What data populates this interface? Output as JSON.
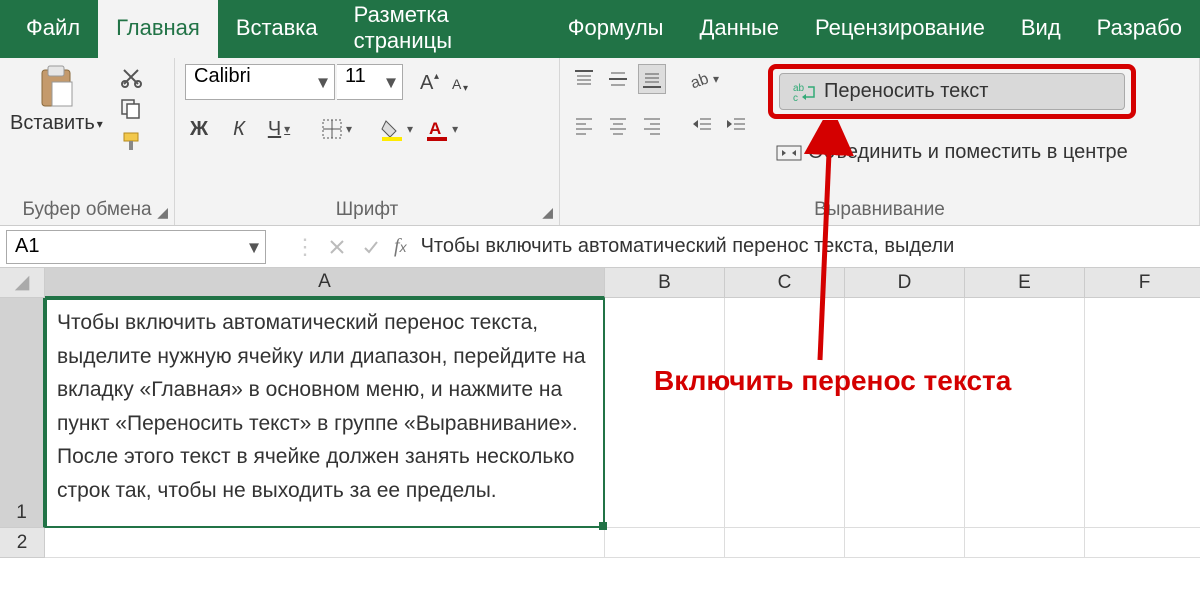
{
  "tabs": {
    "file": "Файл",
    "home": "Главная",
    "insert": "Вставка",
    "page_layout": "Разметка страницы",
    "formulas": "Формулы",
    "data": "Данные",
    "review": "Рецензирование",
    "view": "Вид",
    "developer": "Разрабо"
  },
  "ribbon": {
    "clipboard": {
      "paste": "Вставить",
      "label": "Буфер обмена"
    },
    "font": {
      "name": "Calibri",
      "size": "11",
      "bold": "Ж",
      "italic": "К",
      "underline": "Ч",
      "label": "Шрифт"
    },
    "alignment": {
      "wrap": "Переносить текст",
      "merge": "Объединить и поместить в центре",
      "label": "Выравнивание"
    }
  },
  "formula_bar": {
    "name_box": "A1",
    "content": "Чтобы включить автоматический перенос текста, выдели"
  },
  "grid": {
    "cols": [
      "A",
      "B",
      "C",
      "D",
      "E",
      "F"
    ],
    "rows": [
      "1",
      "2"
    ],
    "cell_a1": "Чтобы включить автоматический перенос текста, выделите нужную ячейку или диапазон, перейдите на вкладку «Главная» в основном меню, и нажмите на пункт «Переносить текст» в группе «Выравнивание». После этого текст в ячейке должен занять несколько строк так, чтобы не выходить за ее пределы."
  },
  "annotation": "Включить перенос текста"
}
